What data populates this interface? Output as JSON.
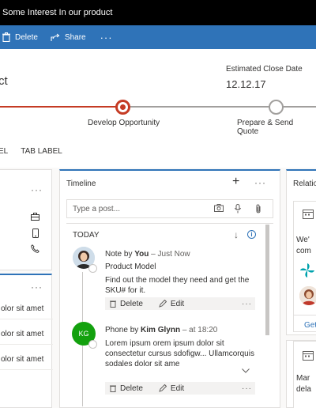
{
  "window": {
    "title": "Some Interest In our product"
  },
  "commandbar": {
    "delete_label": "Delete",
    "share_label": "Share",
    "more_label": "···"
  },
  "header": {
    "record_name": "ct",
    "estimated_close_label": "Estimated Close Date",
    "estimated_close_value": "12.12.17"
  },
  "process": {
    "stages": [
      {
        "label": "Develop Opportunity",
        "state": "active"
      },
      {
        "label": "Prepare & Send Quote",
        "state": "inactive"
      }
    ]
  },
  "tabs": [
    {
      "label": "EL"
    },
    {
      "label": "TAB LABEL"
    }
  ],
  "left_top_card": {
    "more_label": "···"
  },
  "left_bottom_card": {
    "more_label": "···",
    "rows": [
      "olor sit amet",
      "olor sit amet",
      "olor sit amet"
    ]
  },
  "timeline": {
    "title": "Timeline",
    "add_label": "+",
    "more_label": "···",
    "post_placeholder": "Type a post...",
    "group_label": "TODAY",
    "activities": [
      {
        "type": "note",
        "prefix": "Note by ",
        "author": "You",
        "time": " – Just Now",
        "title": "Product Model",
        "body": "Find out the model they need and get the SKU# for it.",
        "delete_label": "Delete",
        "edit_label": "Edit",
        "more_label": "···"
      },
      {
        "type": "phone",
        "prefix": "Phone by ",
        "author": "Kim Glynn",
        "time": " – at 18:20",
        "initials": "KG",
        "body": "Lorem ipsum orem ipsum dolor sit consectetur cursus sdofigw... Ullamcorquis sodales dolor sit ame",
        "delete_label": "Delete",
        "edit_label": "Edit",
        "more_label": "···"
      }
    ]
  },
  "relationship": {
    "title": "Relatio",
    "card1_line1": "We'",
    "card1_line2": "com",
    "get_label": "Get",
    "card2_line1": "Mar",
    "card2_line2": "dela"
  },
  "colors": {
    "brand": "#2f73b8",
    "active_stage": "#c53b24",
    "kg_avatar": "#13a10e"
  }
}
